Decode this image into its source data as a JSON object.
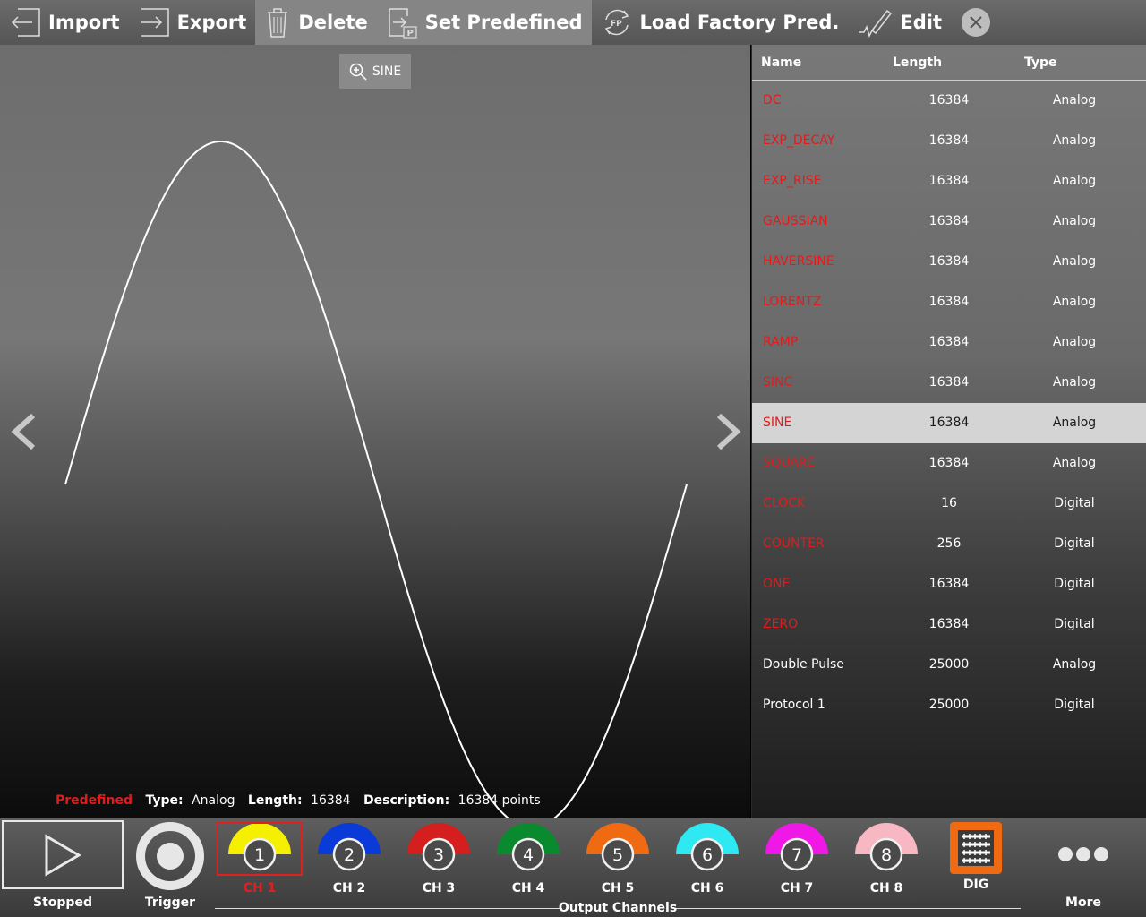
{
  "toolbar": {
    "import_label": "Import",
    "export_label": "Export",
    "delete_label": "Delete",
    "set_predefined_label": "Set Predefined",
    "load_factory_label": "Load Factory Pred.",
    "edit_label": "Edit"
  },
  "waveform": {
    "zoom_label": "SINE",
    "info": {
      "predefined": "Predefined",
      "type_label": "Type:",
      "type_value": "Analog",
      "length_label": "Length:",
      "length_value": "16384",
      "description_label": "Description:",
      "description_value": "16384 points"
    }
  },
  "list": {
    "columns": {
      "name": "Name",
      "length": "Length",
      "type": "Type"
    },
    "rows": [
      {
        "name": "DC",
        "length": "16384",
        "type": "Analog",
        "predefined": true
      },
      {
        "name": "EXP_DECAY",
        "length": "16384",
        "type": "Analog",
        "predefined": true
      },
      {
        "name": "EXP_RISE",
        "length": "16384",
        "type": "Analog",
        "predefined": true
      },
      {
        "name": "GAUSSIAN",
        "length": "16384",
        "type": "Analog",
        "predefined": true
      },
      {
        "name": "HAVERSINE",
        "length": "16384",
        "type": "Analog",
        "predefined": true
      },
      {
        "name": "LORENTZ",
        "length": "16384",
        "type": "Analog",
        "predefined": true
      },
      {
        "name": "RAMP",
        "length": "16384",
        "type": "Analog",
        "predefined": true
      },
      {
        "name": "SINC",
        "length": "16384",
        "type": "Analog",
        "predefined": true
      },
      {
        "name": "SINE",
        "length": "16384",
        "type": "Analog",
        "predefined": true,
        "selected": true
      },
      {
        "name": "SQUARE",
        "length": "16384",
        "type": "Analog",
        "predefined": true
      },
      {
        "name": "CLOCK",
        "length": "16",
        "type": "Digital",
        "predefined": true
      },
      {
        "name": "COUNTER",
        "length": "256",
        "type": "Digital",
        "predefined": true
      },
      {
        "name": "ONE",
        "length": "16384",
        "type": "Digital",
        "predefined": true
      },
      {
        "name": "ZERO",
        "length": "16384",
        "type": "Digital",
        "predefined": true
      },
      {
        "name": "Double Pulse",
        "length": "25000",
        "type": "Analog",
        "predefined": false
      },
      {
        "name": "Protocol 1",
        "length": "25000",
        "type": "Digital",
        "predefined": false
      }
    ]
  },
  "bottom": {
    "play_state": "Stopped",
    "trigger_label": "Trigger",
    "output_channels_label": "Output Channels",
    "more_label": "More",
    "dig_label": "DIG",
    "channels": [
      {
        "num": "1",
        "label": "CH 1",
        "color": "#f5f000",
        "selected": true
      },
      {
        "num": "2",
        "label": "CH 2",
        "color": "#0a3ad8"
      },
      {
        "num": "3",
        "label": "CH 3",
        "color": "#d51e1e"
      },
      {
        "num": "4",
        "label": "CH 4",
        "color": "#0a8a2e"
      },
      {
        "num": "5",
        "label": "CH 5",
        "color": "#f06a12"
      },
      {
        "num": "6",
        "label": "CH 6",
        "color": "#2ee8f2"
      },
      {
        "num": "7",
        "label": "CH 7",
        "color": "#f018e6"
      },
      {
        "num": "8",
        "label": "CH 8",
        "color": "#f7b8c4"
      }
    ]
  },
  "colors": {
    "predefined_text": "#e21b1b",
    "selected_row_bg": "#d4d4d4",
    "dig_accent": "#f06a12"
  }
}
